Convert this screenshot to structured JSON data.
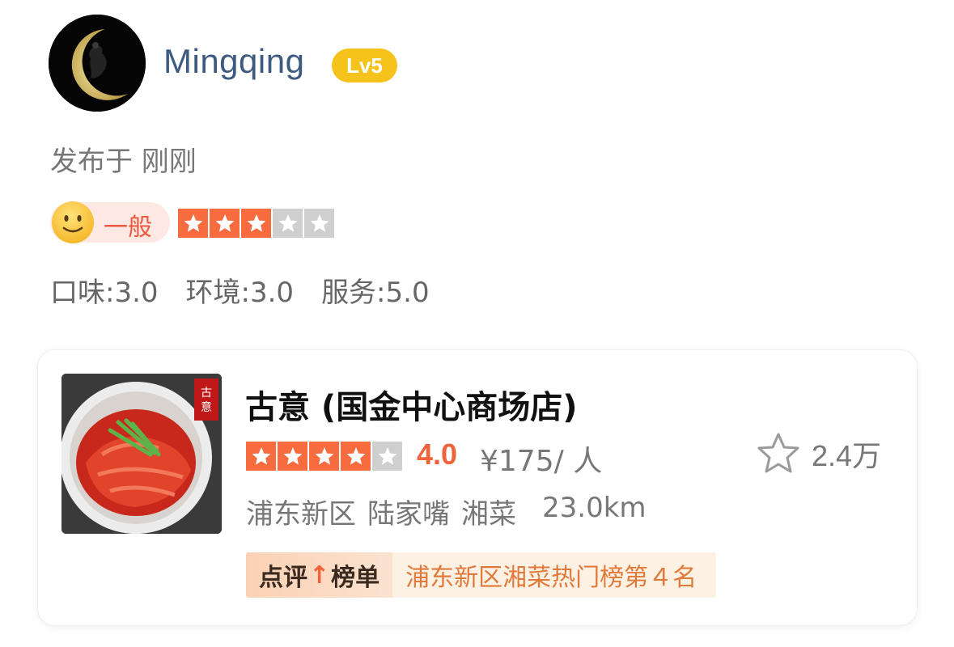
{
  "user": {
    "name": "Mingqing",
    "level": "Lv5"
  },
  "post": {
    "published": "发布于 刚刚"
  },
  "rating": {
    "mood_label": "一般",
    "stars": 3,
    "max_stars": 5,
    "subscores": [
      {
        "label": "口味:3.0"
      },
      {
        "label": "环境:3.0"
      },
      {
        "label": "服务:5.0"
      }
    ]
  },
  "shop": {
    "name": "古意 (国金中心商场店)",
    "stars": 4,
    "max_stars": 5,
    "score": "4.0",
    "price": "¥175/ 人",
    "favorites": "2.4万",
    "district": "浦东新区",
    "area": "陆家嘴",
    "cuisine": "湘菜",
    "distance": "23.0km",
    "rank_brand_left": "点评",
    "rank_brand_arrow": "↑",
    "rank_brand_right": "榜单",
    "rank_text": "浦东新区湘菜热门榜第４名"
  },
  "colors": {
    "accent": "#f66c3f",
    "level_badge": "#f6c21c",
    "username": "#3d5a80"
  }
}
